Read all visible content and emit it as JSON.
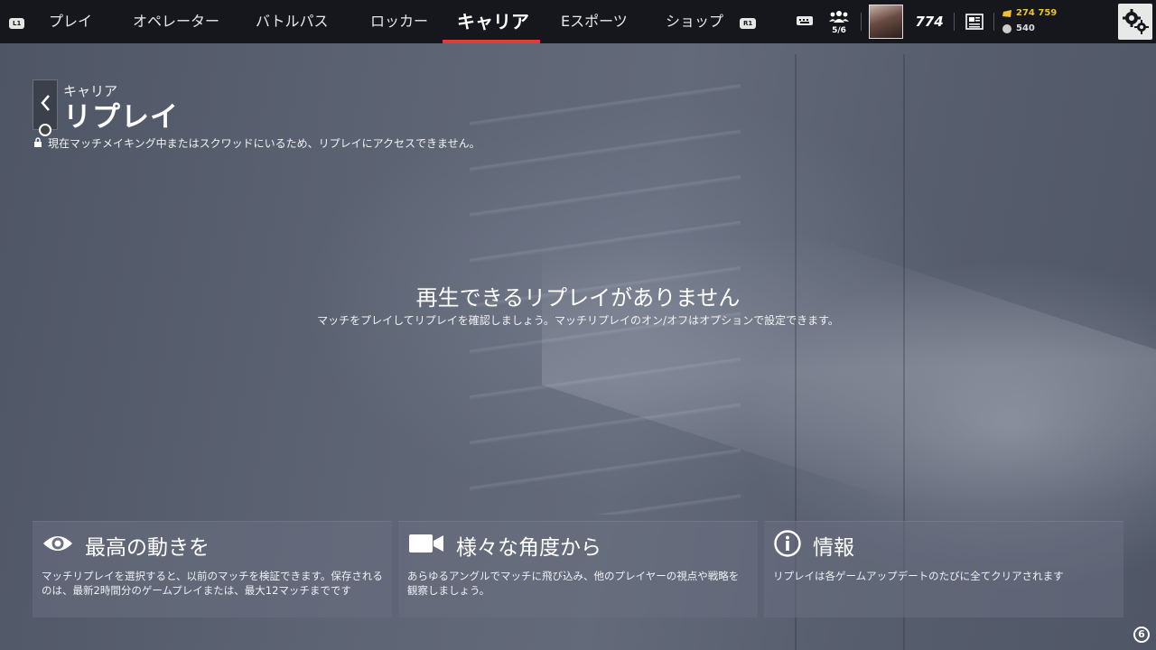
{
  "topbar": {
    "left_bumper": "L1",
    "right_bumper": "R1",
    "tabs": [
      {
        "label": "プレイ"
      },
      {
        "label": "オペレーター"
      },
      {
        "label": "バトルパス"
      },
      {
        "label": "ロッカー"
      },
      {
        "label": "キャリア"
      },
      {
        "label": "Eスポーツ"
      },
      {
        "label": "ショップ"
      }
    ],
    "active_tab": "キャリア",
    "squad_count": "5/6",
    "level": "774",
    "renown": "274 759",
    "credits": "540",
    "accent_color": "#e03a3a",
    "renown_color": "#f0c030"
  },
  "header": {
    "breadcrumb": "キャリア",
    "title": "リプレイ",
    "lock_notice": "現在マッチメイキング中またはスクワッドにいるため、リプレイにアクセスできません。"
  },
  "empty_state": {
    "title": "再生できるリプレイがありません",
    "subtitle": "マッチをプレイしてリプレイを確認しましょう。マッチリプレイのオン/オフはオプションで設定できます。"
  },
  "cards": [
    {
      "icon": "eye-icon",
      "title": "最高の動きを",
      "body": "マッチリプレイを選択すると、以前のマッチを検証できます。保存されるのは、最新2時間分のゲームプレイまたは、最大12マッチまでです"
    },
    {
      "icon": "video-camera-icon",
      "title": "様々な角度から",
      "body": "あらゆるアングルでマッチに飛び込み、他のプレイヤーの視点や戦略を観察しましょう。"
    },
    {
      "icon": "info-icon",
      "title": "情報",
      "body": "リプレイは各ゲームアップデートのたびに全てクリアされます"
    }
  ],
  "corner_badge": "6"
}
